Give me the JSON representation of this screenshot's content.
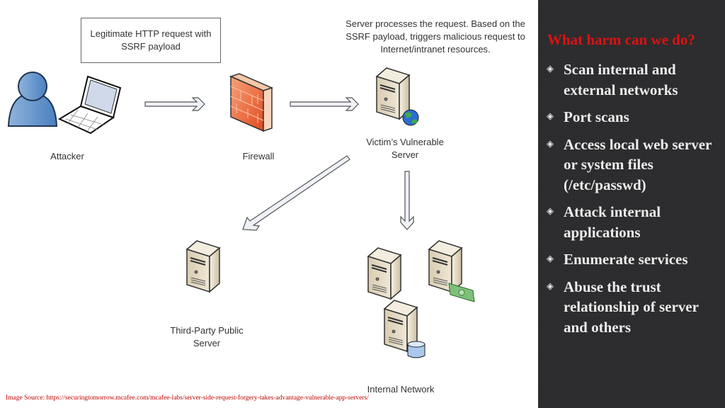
{
  "diagram": {
    "request_box": "Legitimate HTTP request with SSRF payload",
    "server_description": "Server processes the request. Based on the SSRF payload, triggers malicious request to Internet/intranet resources.",
    "nodes": {
      "attacker": "Attacker",
      "firewall": "Firewall",
      "victim_server": "Victim’s Vulnerable Server",
      "third_party": "Third-Party Public Server",
      "internal_network": "Internal Network"
    },
    "source": "Image Source: https://securingtomorrow.mcafee.com/mcafee-labs/server-side-request-forgery-takes-advantage-vulnerable-app-servers/"
  },
  "panel": {
    "title": "What harm can we do?",
    "bullet_icon": "diamond-bullet-icon",
    "bullets": [
      "Scan internal and external networks",
      "Port scans",
      "Access local web server or system files (/etc/passwd)",
      "Attack internal applications",
      "Enumerate services",
      "Abuse the trust relationship of server and others"
    ]
  },
  "colors": {
    "panel_bg": "#2a2a2c",
    "title_red": "#e01010",
    "bullet_text": "#ececec",
    "source_red": "#c00000"
  }
}
